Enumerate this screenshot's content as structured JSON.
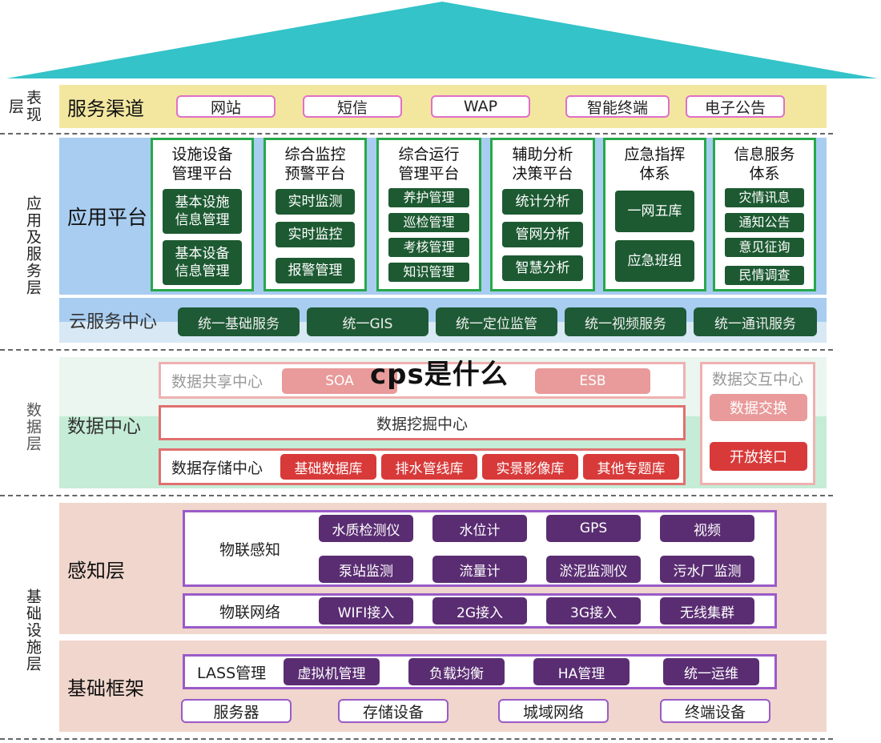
{
  "layers": {
    "presentation": "表现层",
    "application": "应用及服务层",
    "data": "数据层",
    "infrastructure": "基础设施层"
  },
  "service_channels": {
    "title": "服务渠道",
    "items": [
      "网站",
      "短信",
      "WAP",
      "智能终端",
      "电子公告"
    ]
  },
  "app_platform": {
    "title": "应用平台",
    "columns": [
      {
        "title": "设施设备\n管理平台",
        "items": [
          "基本设施\n信息管理",
          "基本设备\n信息管理"
        ]
      },
      {
        "title": "综合监控\n预警平台",
        "items": [
          "实时监测",
          "实时监控",
          "报警管理"
        ]
      },
      {
        "title": "综合运行\n管理平台",
        "items": [
          "养护管理",
          "巡检管理",
          "考核管理",
          "知识管理"
        ]
      },
      {
        "title": "辅助分析\n决策平台",
        "items": [
          "统计分析",
          "管网分析",
          "智慧分析"
        ]
      },
      {
        "title": "应急指挥\n体系",
        "items": [
          "一网五库",
          "应急班组"
        ]
      },
      {
        "title": "信息服务\n体系",
        "items": [
          "灾情讯息",
          "通知公告",
          "意见征询",
          "民情调查"
        ]
      }
    ]
  },
  "cloud_center": {
    "title": "云服务中心",
    "items": [
      "统一基础服务",
      "统一GIS",
      "统一定位监管",
      "统一视频服务",
      "统一通讯服务"
    ]
  },
  "data_center": {
    "title": "数据中心",
    "sharing": {
      "label": "数据共享中心",
      "items": [
        "SOA",
        "ESB"
      ]
    },
    "mining": {
      "label": "数据挖掘中心"
    },
    "storage": {
      "label": "数据存储中心",
      "items": [
        "基础数据库",
        "排水管线库",
        "实景影像库",
        "其他专题库"
      ]
    },
    "interaction": {
      "label": "数据交互中心",
      "items": [
        "数据交换",
        "开放接口"
      ]
    }
  },
  "perception": {
    "title": "感知层",
    "iot_sensing": {
      "label": "物联感知",
      "items": [
        "水质检测仪",
        "水位计",
        "GPS",
        "视频",
        "泵站监测",
        "流量计",
        "淤泥监测仪",
        "污水厂监测"
      ]
    },
    "iot_network": {
      "label": "物联网络",
      "items": [
        "WIFI接入",
        "2G接入",
        "3G接入",
        "无线集群"
      ]
    }
  },
  "framework": {
    "title": "基础框架",
    "lass": {
      "label": "LASS管理",
      "items": [
        "虚拟机管理",
        "负载均衡",
        "HA管理",
        "统一运维"
      ]
    },
    "bottom": [
      "服务器",
      "存储设备",
      "城域网络",
      "终端设备"
    ]
  },
  "overlay_title": "cps是什么",
  "colors": {
    "roof": "#33c3c8",
    "presentation_bg": "#f3e7a0",
    "application_bg": "#a8cdf0",
    "data_bg": "#cdeedd",
    "perception_bg": "#f0d6cc",
    "dark_green": "#1d5a32",
    "red": "#d83a3a",
    "purple": "#5a2d72"
  }
}
